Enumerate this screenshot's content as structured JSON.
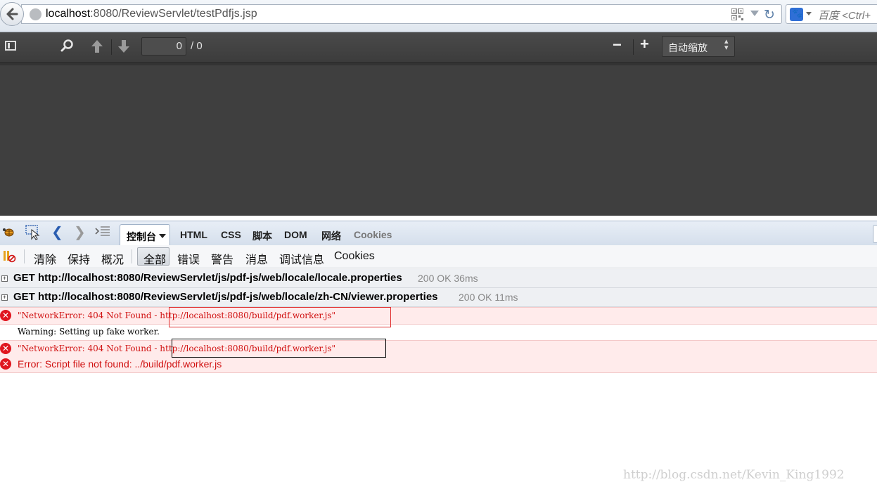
{
  "browser": {
    "url_host": "localhost",
    "url_rest": ":8080/ReviewServlet/testPdfjs.jsp",
    "search_placeholder": "百度 <Ctrl+"
  },
  "pdf_toolbar": {
    "page_value": "0",
    "page_count": "/ 0",
    "zoom_out": "−",
    "zoom_in": "+",
    "scale_label": "自动缩放"
  },
  "firebug": {
    "tabs": {
      "console": "控制台",
      "html": "HTML",
      "css": "CSS",
      "script": "脚本",
      "dom": "DOM",
      "net": "网络",
      "cookies": "Cookies"
    },
    "toolbar": {
      "clear": "清除",
      "persist": "保持",
      "profile": "概况",
      "all": "全部",
      "errors": "错误",
      "warnings": "警告",
      "info": "消息",
      "debug": "调试信息",
      "cookies": "Cookies"
    },
    "log": {
      "req1_text": "GET http://localhost:8080/ReviewServlet/js/pdf-js/web/locale/locale.properties",
      "req1_status": "200 OK 36ms",
      "req2_text": "GET http://localhost:8080/ReviewServlet/js/pdf-js/web/locale/zh-CN/viewer.properties",
      "req2_status": "200 OK 11ms",
      "err1_text": "\"NetworkError: 404 Not Found - http://localhost:8080/build/pdf.worker.js\"",
      "warn_text": "Warning: Setting up fake worker.",
      "err2_text": "\"NetworkError: 404 Not Found - http://localhost:8080/build/pdf.worker.js\"",
      "err3_text": "Error: Script file not found: ../build/pdf.worker.js"
    }
  },
  "watermark": "http://blog.csdn.net/Kevin_King1992",
  "colors": {
    "error_red": "#d01010",
    "highlight_red": "#e03030",
    "highlight_black": "#000000",
    "viewer_bg": "#3f3f3f"
  }
}
